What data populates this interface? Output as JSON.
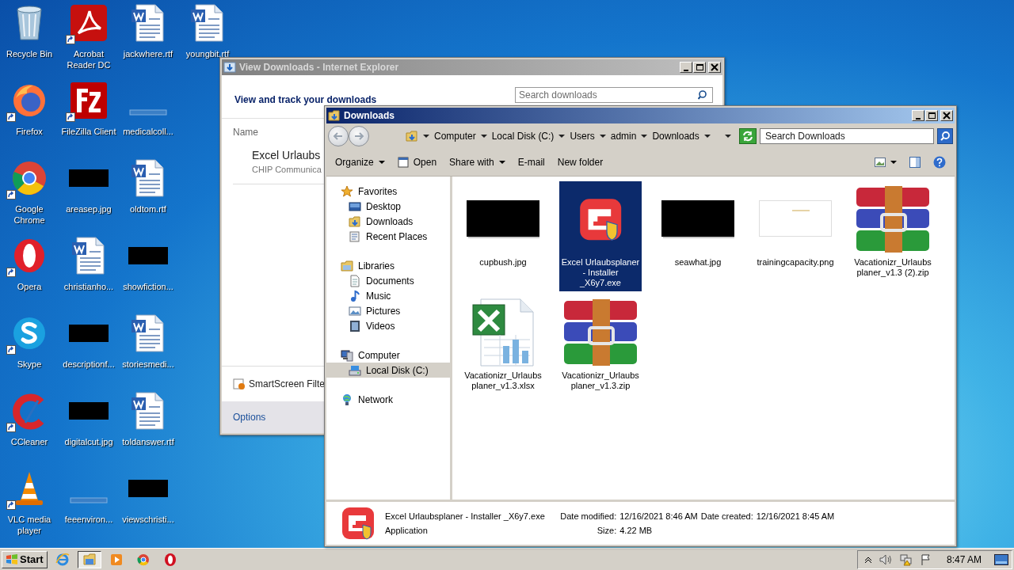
{
  "desktop": {
    "icons": [
      {
        "label": "Recycle Bin",
        "kind": "recycle",
        "shortcut": false
      },
      {
        "label": "Firefox",
        "kind": "firefox",
        "shortcut": true
      },
      {
        "label": "Google Chrome",
        "kind": "chrome",
        "shortcut": true
      },
      {
        "label": "Opera",
        "kind": "opera",
        "shortcut": true
      },
      {
        "label": "Skype",
        "kind": "skype",
        "shortcut": true
      },
      {
        "label": "CCleaner",
        "kind": "ccleaner",
        "shortcut": true
      },
      {
        "label": "VLC media player",
        "kind": "vlc",
        "shortcut": true
      },
      {
        "label": "Acrobat Reader DC",
        "kind": "acrobat",
        "shortcut": true
      },
      {
        "label": "FileZilla Client",
        "kind": "filezilla",
        "shortcut": true
      },
      {
        "label": "areasep.jpg",
        "kind": "dark",
        "shortcut": false
      },
      {
        "label": "christianho...",
        "kind": "word",
        "shortcut": false
      },
      {
        "label": "descriptionf...",
        "kind": "dark",
        "shortcut": false
      },
      {
        "label": "digitalcut.jpg",
        "kind": "dark",
        "shortcut": false
      },
      {
        "label": "feeenviron...",
        "kind": "blank",
        "shortcut": false
      },
      {
        "label": "jackwhere.rtf",
        "kind": "word",
        "shortcut": false
      },
      {
        "label": "medicalcoll...",
        "kind": "blank",
        "shortcut": false
      },
      {
        "label": "oldtom.rtf",
        "kind": "word",
        "shortcut": false
      },
      {
        "label": "showfiction...",
        "kind": "dark",
        "shortcut": false
      },
      {
        "label": "storiesmedi...",
        "kind": "word",
        "shortcut": false
      },
      {
        "label": "toldanswer.rtf",
        "kind": "word",
        "shortcut": false
      },
      {
        "label": "viewschristi...",
        "kind": "dark",
        "shortcut": false
      },
      {
        "label": "youngbit.rtf",
        "kind": "word",
        "shortcut": false
      }
    ]
  },
  "ie_window": {
    "title": "View Downloads - Internet Explorer",
    "active": false,
    "heading": "View and track your downloads",
    "search": {
      "placeholder": "Search downloads"
    },
    "column": "Name",
    "downloads": [
      {
        "name": "Excel Urlaubs",
        "source": "CHIP Communica"
      }
    ],
    "smartscreen": "SmartScreen Filte",
    "options": "Options"
  },
  "explorer": {
    "title": "Downloads",
    "active": true,
    "breadcrumb": [
      "Computer",
      "Local Disk (C:)",
      "Users",
      "admin",
      "Downloads"
    ],
    "search": {
      "placeholder": "Search Downloads"
    },
    "toolbar": [
      {
        "label": "Organize",
        "kind": "menu"
      },
      {
        "label": "Open",
        "kind": "open"
      },
      {
        "label": "Share with",
        "kind": "menu"
      },
      {
        "label": "E-mail",
        "kind": "plain"
      },
      {
        "label": "New folder",
        "kind": "plain"
      }
    ],
    "nav": [
      {
        "label": "Favorites",
        "kind": "star",
        "selected": false,
        "children": [
          {
            "label": "Desktop",
            "kind": "desktop",
            "selected": false
          },
          {
            "label": "Downloads",
            "kind": "downloads",
            "selected": false
          },
          {
            "label": "Recent Places",
            "kind": "recent",
            "selected": false
          }
        ]
      },
      {
        "label": "Libraries",
        "kind": "libraries",
        "selected": false,
        "children": [
          {
            "label": "Documents",
            "kind": "documents",
            "selected": false
          },
          {
            "label": "Music",
            "kind": "music",
            "selected": false
          },
          {
            "label": "Pictures",
            "kind": "pictures",
            "selected": false
          },
          {
            "label": "Videos",
            "kind": "videos",
            "selected": false
          }
        ]
      },
      {
        "label": "Computer",
        "kind": "computer",
        "selected": false,
        "children": [
          {
            "label": "Local Disk (C:)",
            "kind": "disk",
            "selected": true
          }
        ]
      },
      {
        "label": "Network",
        "kind": "network",
        "selected": false
      }
    ],
    "files": [
      {
        "name": "cupbush.jpg",
        "kind": "dark",
        "selected": false
      },
      {
        "name": "Excel Urlaubsplaner - Installer _X6y7.exe",
        "kind": "installer",
        "selected": true
      },
      {
        "name": "seawhat.jpg",
        "kind": "dark",
        "selected": false
      },
      {
        "name": "trainingcapacity.png",
        "kind": "light",
        "selected": false
      },
      {
        "name": "Vacationizr_Urlaubsplaner_v1.3 (2).zip",
        "kind": "archive",
        "selected": false
      },
      {
        "name": "Vacationizr_Urlaubsplaner_v1.3.xlsx",
        "kind": "spreadsheet",
        "selected": false
      },
      {
        "name": "Vacationizr_Urlaubsplaner_v1.3.zip",
        "kind": "archive",
        "selected": false
      }
    ],
    "details": {
      "name": "Excel Urlaubsplaner - Installer _X6y7.exe",
      "type": "Application",
      "fields": [
        {
          "label": "Date modified:",
          "value": "12/16/2021 8:46 AM"
        },
        {
          "label": "Size:",
          "value": "4.22 MB"
        },
        {
          "label": "Date created:",
          "value": "12/16/2021 8:45 AM"
        }
      ]
    }
  },
  "taskbar": {
    "start": "Start",
    "apps": [
      {
        "kind": "ie",
        "active": false
      },
      {
        "kind": "explorer",
        "active": true
      },
      {
        "kind": "media",
        "active": false
      },
      {
        "kind": "chrome",
        "active": false
      },
      {
        "kind": "opera",
        "active": false
      }
    ],
    "clock": "8:47 AM"
  }
}
